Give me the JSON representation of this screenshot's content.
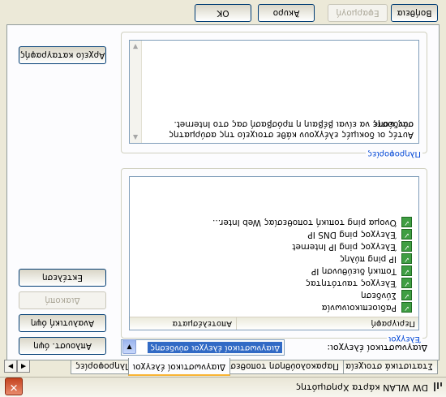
{
  "window": {
    "title": "DW WLAN κάρτα Χρησιμότης",
    "icon": "wifi-signal-icon",
    "close_glyph": "✕"
  },
  "tabs": [
    {
      "label": "Στατιστικά στοιχεία"
    },
    {
      "label": "Παρακολούθηση τοποθεσίας"
    },
    {
      "label": "Διαγνωστικοί έλεγχοι",
      "active": true
    },
    {
      "label": "Πληροφορίες"
    }
  ],
  "tab_nav": {
    "prev": "◀",
    "next": "▶"
  },
  "diagnostics": {
    "label": "Διαγνωστικοί έλεγχοι:",
    "selected": "Διαγνωστικοί έλεγχοι σύνδεσης",
    "dropdown_glyph": "▼"
  },
  "tests_group": {
    "label": "Έλεγχοι",
    "columns": [
      "Περιγραφή",
      "Αποτελέσματα"
    ],
    "items": [
      {
        "label": "Ραδιοεπικοινωνία",
        "status": "pass"
      },
      {
        "label": "Σύνδεση",
        "status": "pass"
      },
      {
        "label": "Έλεγχος ταυτότητας",
        "status": "pass"
      },
      {
        "label": "Τοπική διεύθυνση IP",
        "status": "pass"
      },
      {
        "label": "IP ping πύλης",
        "status": "pass"
      },
      {
        "label": "Έλεγχος ping IP Internet",
        "status": "pass"
      },
      {
        "label": "Έλεγχος ping DNS IP",
        "status": "pass"
      },
      {
        "label": "Όνομα ping τοπική τοποθεσίας Web Inter...",
        "status": "pass"
      }
    ],
    "check_glyph": "✓"
  },
  "info_group": {
    "label": "Πληροφορίες",
    "text_line1": "Αυτές οι δοκιμές ελέγχουν κάθε στοιχείο της ασύρματης σύνδεσης",
    "text_line2": "σας ώστε να είναι βέβαιη η πρόσβασή σας στο Internet."
  },
  "side_buttons": {
    "run": "Εκτέλεση",
    "stop": "Διακοπή",
    "log": "Αρχείο καταγραφής",
    "analyze": "Αναλυτική όψη",
    "simple": "Απλουστ. όψη"
  },
  "bottom_buttons": {
    "ok": "OK",
    "cancel": "Άκυρο",
    "apply": "Εφαρμογή",
    "help": "Βοήθεια"
  },
  "scroll_glyphs": {
    "up": "▲",
    "down": "▼"
  },
  "colors": {
    "check_green": "#3f9e43",
    "group_label_blue": "#0046d5",
    "selection_blue": "#316ac5"
  }
}
